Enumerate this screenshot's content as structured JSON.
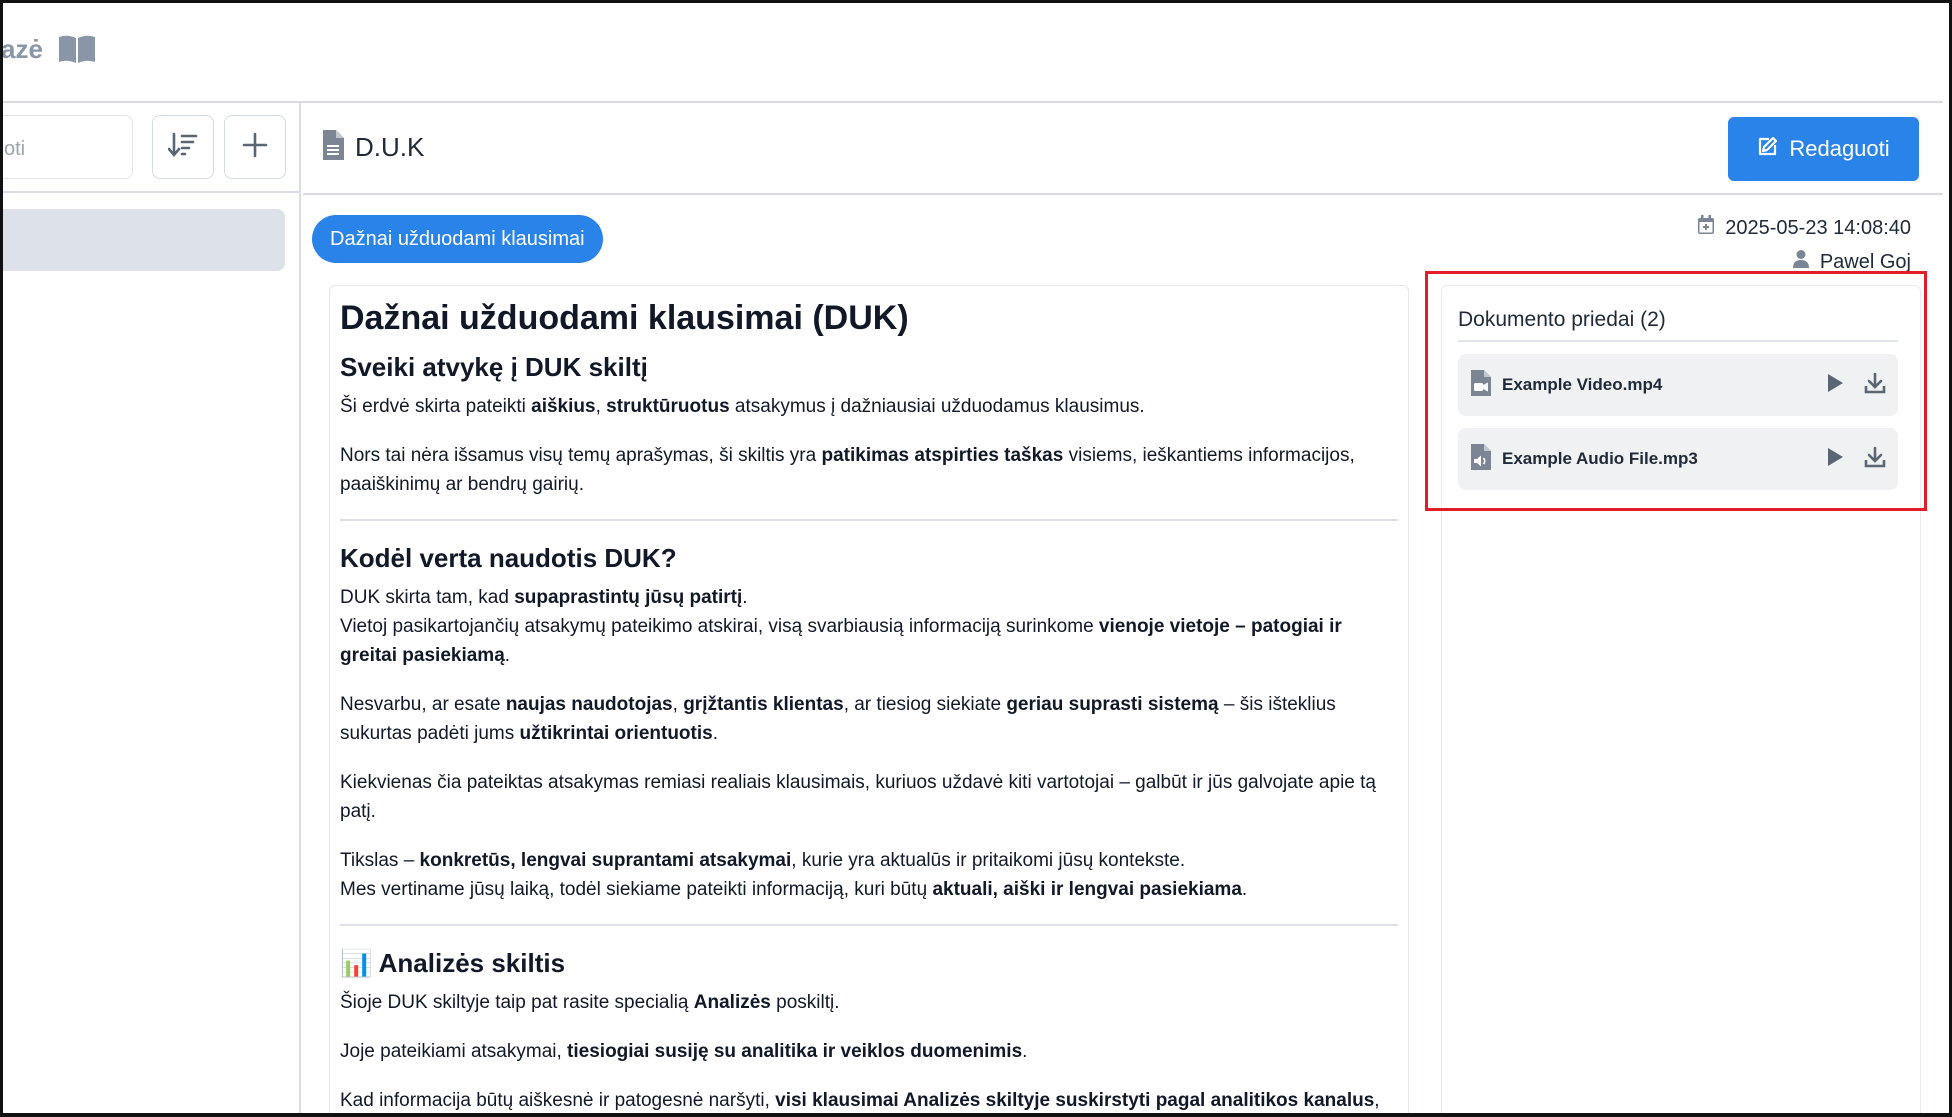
{
  "brand": {
    "text": "azė"
  },
  "sidebar": {
    "search_placeholder": "oti"
  },
  "document": {
    "title": "D.U.K",
    "edit_label": "Redaguoti",
    "category": "Dažnai užduodami klausimai",
    "date": "2025-05-23 14:08:40",
    "author": "Pawel Goj"
  },
  "content": {
    "h1": "Dažnai užduodami klausimai (DUK)",
    "h2_welcome": "Sveiki atvykę į DUK skiltį",
    "p1": {
      "a": "Ši erdvė skirta pateikti ",
      "b1": "aiškius",
      "c": ", ",
      "b2": "struktūruotus",
      "d": " atsakymus į dažniausiai užduodamus klausimus."
    },
    "p2": {
      "a": "Nors tai nėra išsamus visų temų aprašymas, ši skiltis yra ",
      "b1": "patikimas atspirties taškas",
      "c": " visiems, ieškantiems informacijos, paaiškinimų ar bendrų gairių."
    },
    "h2_why": "Kodėl verta naudotis DUK?",
    "p3": {
      "a": "DUK skirta tam, kad ",
      "b1": "supaprastintų jūsų patirtį",
      "c": ".",
      "d": "Vietoj pasikartojančių atsakymų pateikimo atskirai, visą svarbiausią informaciją surinkome ",
      "b2": "vienoje vietoje – patogiai ir greitai pasiekiamą",
      "e": "."
    },
    "p4": {
      "a": "Nesvarbu, ar esate ",
      "b1": "naujas naudotojas",
      "c": ", ",
      "b2": "grįžtantis klientas",
      "d": ", ar tiesiog siekiate ",
      "b3": "geriau suprasti sistemą",
      "e": " – šis išteklius sukurtas padėti jums ",
      "b4": "užtikrintai orientuotis",
      "f": "."
    },
    "p5": "Kiekvienas čia pateiktas atsakymas remiasi realiais klausimais, kuriuos uždavė kiti vartotojai – galbūt ir jūs galvojate apie tą patį.",
    "p6": {
      "a": "Tikslas – ",
      "b1": "konkretūs, lengvai suprantami atsakymai",
      "c": ", kurie yra aktualūs ir pritaikomi jūsų kontekste.",
      "d": "Mes vertiname jūsų laiką, todėl siekiame pateikti informaciją, kuri būtų ",
      "b2": "aktuali, aiški ir lengvai pasiekiama",
      "e": "."
    },
    "h2_analysis_emoji": "📊",
    "h2_analysis": "Analizės skiltis",
    "p7": {
      "a": "Šioje DUK skiltyje taip pat rasite specialią ",
      "b1": "Analizės",
      "c": " poskiltį."
    },
    "p8": {
      "a": "Joje pateikiami atsakymai, ",
      "b1": "tiesiogiai susiję su analitika ir veiklos duomenimis",
      "c": "."
    },
    "p9": {
      "a": "Kad informacija būtų aiškesnė ir patogesnė naršyti, ",
      "b1": "visi klausimai Analizės skiltyje suskirstyti pagal analitikos kanalus",
      "c": ","
    }
  },
  "attachments": {
    "title": "Dokumento priedai (2)",
    "items": [
      {
        "name": "Example Video.mp4",
        "icon": "video-file-icon"
      },
      {
        "name": "Example Audio File.mp3",
        "icon": "audio-file-icon"
      }
    ]
  },
  "colors": {
    "accent": "#2a83e8",
    "highlight": "#e11d2a"
  }
}
